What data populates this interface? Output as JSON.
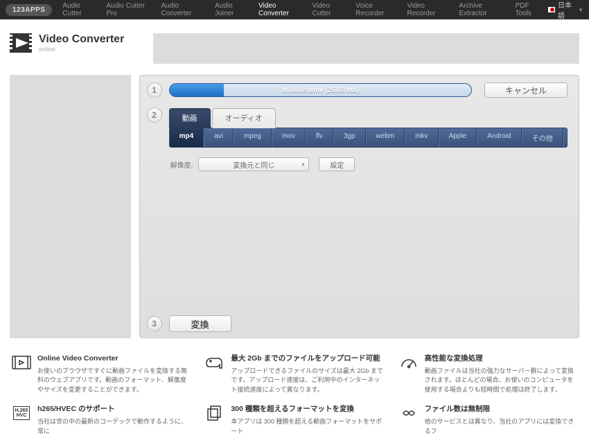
{
  "brand": "123APPS",
  "nav": [
    "Audio Cutter",
    "Audio Cutter Pro",
    "Audio Converter",
    "Audio Joiner",
    "Video Converter",
    "Video Cutter",
    "Voice Recorder",
    "Video Recorder",
    "Archive Extractor",
    "PDF Tools"
  ],
  "nav_active_index": 4,
  "lang": "日本語",
  "title": "Video Converter",
  "subtitle": "online",
  "step1": {
    "filename": "Wildlife.wmv (25.03 Mb)",
    "cancel": "キャンセル"
  },
  "step2": {
    "tabs": [
      "動画",
      "オーディオ"
    ],
    "tab_active_index": 0,
    "formats": [
      "mp4",
      "avi",
      "mpeg",
      "mov",
      "flv",
      "3gp",
      "webm",
      "mkv",
      "Apple",
      "Android",
      "その他"
    ],
    "format_active_index": 0,
    "res_label": "解像度:",
    "res_value": "変換元と同じ",
    "settings": "設定"
  },
  "step3": {
    "convert": "変換"
  },
  "features": [
    [
      {
        "title": "Online Video Converter",
        "desc": "お使いのブラウザですぐに動画ファイルを変換する無料のウェブアプリです。動画のフォーマット、解像度やサイズを変更することができます。"
      },
      {
        "title": "h265/HVEC のサポート",
        "desc": "当社は世の中の最新のコーデックで動作するように、常に"
      }
    ],
    [
      {
        "title": "最大 2Gb までのファイルをアップロード可能",
        "desc": "アップロードできるファイルのサイズは最大 2Gb までです。アップロード速度は、ご利用中のインターネット接続速度によって異なります。"
      },
      {
        "title": "300 種類を超えるフォーマットを変換",
        "desc": "本アプリは 300 種類を超える動画フォーマットをサポート"
      }
    ],
    [
      {
        "title": "高性能な変換処理",
        "desc": "動画ファイルは当社の強力なサーバー群によって変換されます。ほとんどの場合、お使いのコンピュータを使用する場合よりも短時間で処理は終了します。"
      },
      {
        "title": "ファイル数は無制限",
        "desc": "他のサービスとは異なり、当社のアプリには変換できるフ"
      }
    ]
  ]
}
